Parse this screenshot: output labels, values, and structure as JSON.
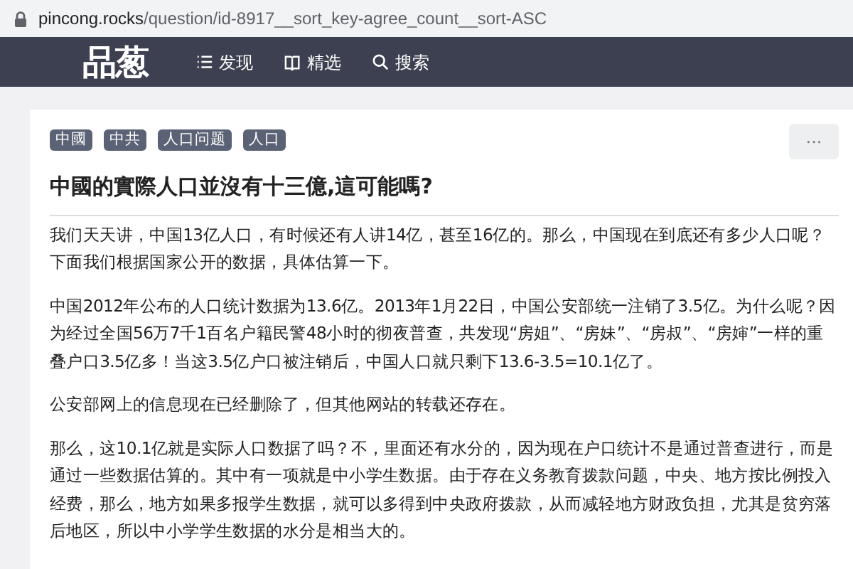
{
  "address_bar": {
    "url": "pincong.rocks/question/id-8917__sort_key-agree_count__sort-ASC"
  },
  "navbar": {
    "logo": "品葱",
    "items": [
      {
        "label": "发现",
        "kind": "list"
      },
      {
        "label": "精选",
        "kind": "book"
      },
      {
        "label": "搜索",
        "kind": "search"
      }
    ]
  },
  "question": {
    "tags": [
      "中國",
      "中共",
      "人口问题",
      "人口"
    ],
    "more_button": "···",
    "title": "中國的實際人口並沒有十三億,這可能嗎?",
    "paragraphs": [
      "我们天天讲，中国13亿人口，有时候还有人讲14亿，甚至16亿的。那么，中国现在到底还有多少人口呢？下面我们根据国家公开的数据，具体估算一下。",
      "中国2012年公布的人口统计数据为13.6亿。2013年1月22日，中国公安部统一注销了3.5亿。为什么呢？因为经过全国56万7千1百名户籍民警48小时的彻夜普查，共发现“房姐”、“房妹”、“房叔”、“房婶”一样的重叠户口3.5亿多！当这3.5亿户口被注销后，中国人口就只剩下13.6-3.5=10.1亿了。",
      "公安部网上的信息现在已经删除了，但其他网站的转载还存在。",
      "那么，这10.1亿就是实际人口数据了吗？不，里面还有水分的，因为现在户口统计不是通过普查进行，而是通过一些数据估算的。其中有一项就是中小学生数据。由于存在义务教育拨款问题，中央、地方按比例投入经费，那么，地方如果多报学生数据，就可以多得到中央政府拨款，从而减轻地方财政负担，尤其是贫穷落后地区，所以中小学学生数据的水分是相当大的。"
    ]
  }
}
